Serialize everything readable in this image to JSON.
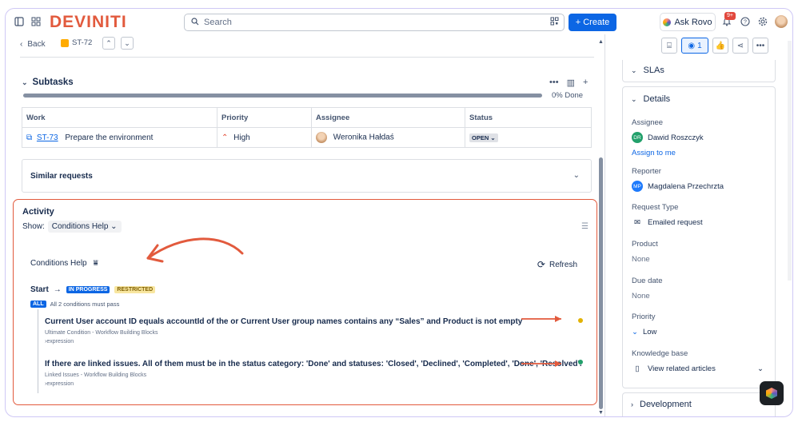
{
  "topbar": {
    "logo": "DEVINITI",
    "search_placeholder": "Search",
    "create_label": "+ Create",
    "ask_rovo_label": "Ask Rovo",
    "notification_badge": "9+"
  },
  "breadcrumb": {
    "back_label": "Back",
    "issue_key": "ST-72"
  },
  "subtasks": {
    "title": "Subtasks",
    "progress_percent": 0,
    "progress_label": "0% Done",
    "columns": [
      "Work",
      "Priority",
      "Assignee",
      "Status"
    ],
    "rows": [
      {
        "key": "ST-73",
        "summary": "Prepare the environment",
        "priority": "High",
        "assignee": "Weronika Hałdaś",
        "status": "OPEN"
      }
    ]
  },
  "similar_requests": {
    "title": "Similar requests"
  },
  "activity": {
    "title": "Activity",
    "show_label": "Show:",
    "show_value": "Conditions Help",
    "conditions_help": {
      "title": "Conditions Help",
      "refresh_label": "Refresh",
      "start_label": "Start",
      "in_progress_label": "IN PROGRESS",
      "restricted_label": "RESTRICTED",
      "all_label": "ALL",
      "all_text": "All 2 conditions must pass",
      "conditions": [
        {
          "text": "Current User account ID equals accountId of the or Current User group names contains any “Sales” and Product is not empty",
          "source": "Ultimate Condition - Workflow Building Blocks",
          "expr": "›expression",
          "status_color": "#e2b203"
        },
        {
          "text": "If there are linked issues. All of them must be in the status category: 'Done' and statuses: 'Closed', 'Declined', 'Completed', 'Done', 'Resolved'.",
          "source": "Linked Issues - Workflow Building Blocks",
          "expr": "›expression",
          "status_color": "#22a06b"
        }
      ]
    }
  },
  "right_panel": {
    "watch_count": "1",
    "slas_title": "SLAs",
    "details_title": "Details",
    "assignee_label": "Assignee",
    "assignee_initials": "DR",
    "assignee_name": "Dawid Roszczyk",
    "assign_to_me": "Assign to me",
    "reporter_label": "Reporter",
    "reporter_initials": "MP",
    "reporter_name": "Magdalena Przechrzta",
    "request_type_label": "Request Type",
    "request_type_value": "Emailed request",
    "product_label": "Product",
    "product_value": "None",
    "due_date_label": "Due date",
    "due_date_value": "None",
    "priority_label": "Priority",
    "priority_value": "Low",
    "knowledge_base_label": "Knowledge base",
    "knowledge_base_value": "View related articles",
    "development_title": "Development"
  },
  "colors": {
    "brand": "#e25a3d",
    "accent": "#0c66e4",
    "annotation": "#e25a3d"
  }
}
